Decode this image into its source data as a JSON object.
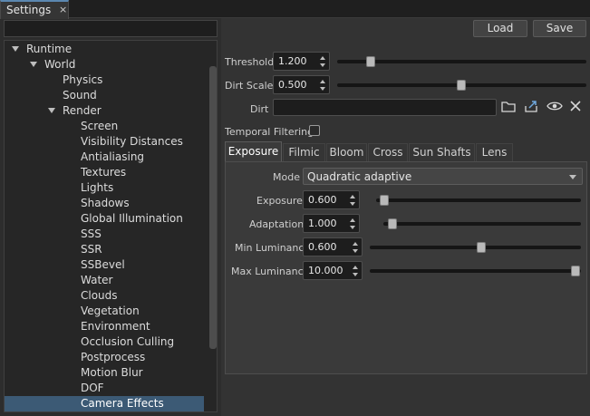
{
  "window": {
    "tab_title": "Settings",
    "tab_close": "×"
  },
  "filter": {
    "value": "",
    "placeholder": ""
  },
  "tree": {
    "items": [
      {
        "label": "Runtime",
        "expanded": true
      },
      {
        "label": "World",
        "expanded": true
      },
      {
        "label": "Physics"
      },
      {
        "label": "Sound"
      },
      {
        "label": "Render",
        "expanded": true
      },
      {
        "label": "Screen"
      },
      {
        "label": "Visibility Distances"
      },
      {
        "label": "Antialiasing"
      },
      {
        "label": "Textures"
      },
      {
        "label": "Lights"
      },
      {
        "label": "Shadows"
      },
      {
        "label": "Global Illumination"
      },
      {
        "label": "SSS"
      },
      {
        "label": "SSR"
      },
      {
        "label": "SSBevel"
      },
      {
        "label": "Water"
      },
      {
        "label": "Clouds"
      },
      {
        "label": "Vegetation"
      },
      {
        "label": "Environment"
      },
      {
        "label": "Occlusion Culling"
      },
      {
        "label": "Postprocess"
      },
      {
        "label": "Motion Blur"
      },
      {
        "label": "DOF"
      },
      {
        "label": "Camera Effects",
        "selected": true
      }
    ]
  },
  "toolbar": {
    "load_label": "Load",
    "save_label": "Save"
  },
  "threshold": {
    "label": "Threshold",
    "value": "1.200",
    "slider": 0.06
  },
  "dirt_scale": {
    "label": "Dirt Scale",
    "value": "0.500",
    "slider": 0.5
  },
  "dirt": {
    "label": "Dirt",
    "value": ""
  },
  "temporal": {
    "label": "Temporal Filtering",
    "checked": false
  },
  "tabs": [
    {
      "label": "Exposure",
      "active": true
    },
    {
      "label": "Filmic"
    },
    {
      "label": "Bloom"
    },
    {
      "label": "Cross"
    },
    {
      "label": "Sun Shafts"
    },
    {
      "label": "Lens"
    }
  ],
  "exposure": {
    "mode_label": "Mode",
    "mode_value": "Quadratic adaptive",
    "exposure_label": "Exposure",
    "exposure_value": "0.600",
    "exposure_slider": 0.03,
    "adaptation_label": "Adaptation",
    "adaptation_value": "1.000",
    "adaptation_slider": 0.08,
    "min_lum_label": "Min Luminance",
    "min_lum_value": "0.600",
    "min_lum_slider": 0.5,
    "max_lum_label": "Max Luminance",
    "max_lum_value": "10.000",
    "max_lum_slider": 1.0
  },
  "colors": {
    "accent": "#5b87b0",
    "selection": "#3c5a75"
  }
}
